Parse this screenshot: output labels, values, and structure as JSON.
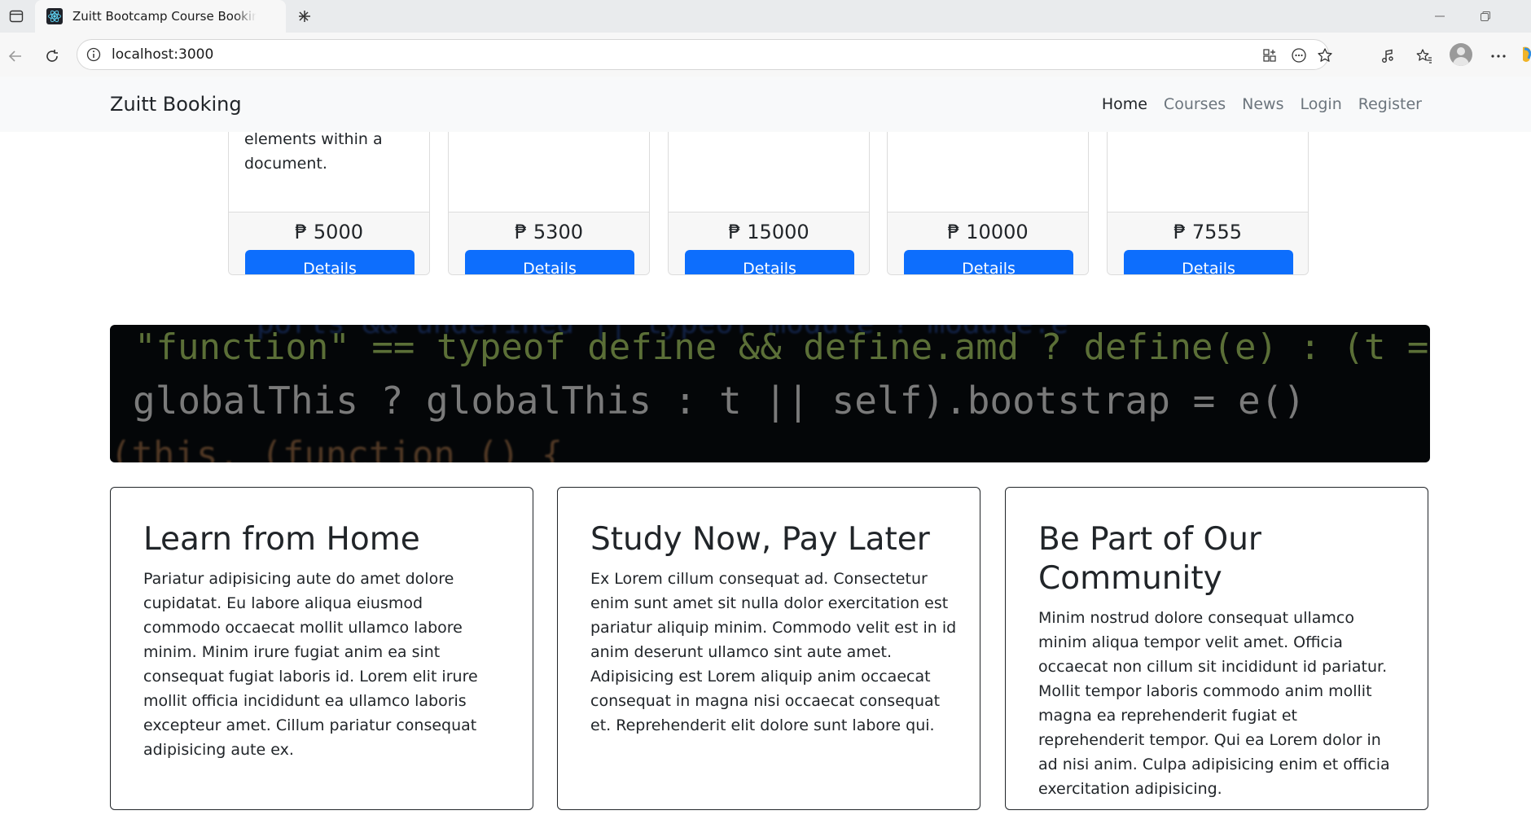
{
  "browser": {
    "tab_title": "Zuitt Bootcamp Course Booking S",
    "url": "localhost:3000"
  },
  "navbar": {
    "brand": "Zuitt Booking",
    "links": [
      "Home",
      "Courses",
      "News",
      "Login",
      "Register"
    ],
    "active": "Home"
  },
  "courses": [
    {
      "description": "tags to define elements within a document.",
      "price": "₱ 5000",
      "button": "Details"
    },
    {
      "description": "",
      "price": "₱ 5300",
      "button": "Details"
    },
    {
      "description": "",
      "price": "₱ 15000",
      "button": "Details"
    },
    {
      "description": "",
      "price": "₱ 10000",
      "button": "Details"
    },
    {
      "description": "",
      "price": "₱ 7555",
      "button": "Details"
    }
  ],
  "banner": {
    "code_lines": [
      "\"function\" == typeof define && define.amd ? define(e) : (t = \"undefi",
      "globalThis ? globalThis : t || self).bootstrap = e()",
      "(this, (function () {",
      "ports && undefined || typeof module ? module.e"
    ]
  },
  "features": [
    {
      "title": "Learn from Home",
      "text": "Pariatur adipisicing aute do amet dolore cupidatat. Eu labore aliqua eiusmod commodo occaecat mollit ullamco labore minim. Minim irure fugiat anim ea sint consequat fugiat laboris id. Lorem elit irure mollit officia incididunt ea ullamco laboris excepteur amet. Cillum pariatur consequat adipisicing aute ex."
    },
    {
      "title": "Study Now, Pay Later",
      "text": "Ex Lorem cillum consequat ad. Consectetur enim sunt amet sit nulla dolor exercitation est pariatur aliquip minim. Commodo velit est in id anim deserunt ullamco sint aute amet. Adipisicing est Lorem aliquip anim occaecat consequat in magna nisi occaecat consequat et. Reprehenderit elit dolore sunt labore qui."
    },
    {
      "title": "Be Part of Our Community",
      "text": "Minim nostrud dolore consequat ullamco minim aliqua tempor velit amet. Officia occaecat non cillum sit incididunt id pariatur. Mollit tempor laboris commodo anim mollit magna ea reprehenderit fugiat et reprehenderit tempor. Qui ea Lorem dolor in ad nisi anim. Culpa adipisicing enim et officia exercitation adipisicing."
    }
  ],
  "colors": {
    "primary": "#0d6efd",
    "navbar_bg": "#f8f9fa",
    "card_footer_bg": "#f7f7f7",
    "text": "#212529",
    "muted": "#6c757d"
  }
}
